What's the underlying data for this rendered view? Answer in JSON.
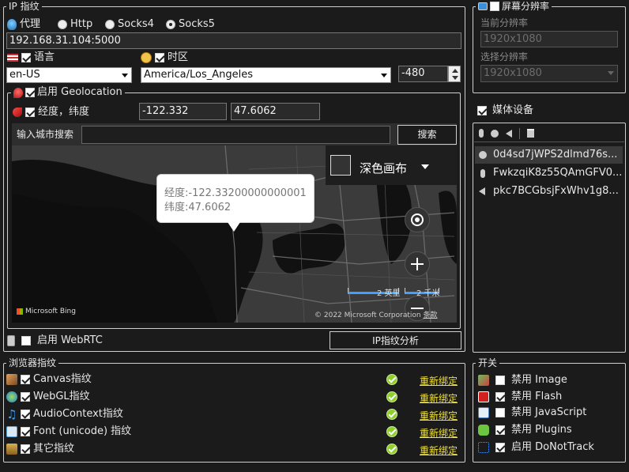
{
  "ip": {
    "title": "IP 指纹",
    "proxy_label": "代理",
    "protocols": [
      {
        "label": "Http",
        "selected": false
      },
      {
        "label": "Socks4",
        "selected": false
      },
      {
        "label": "Socks5",
        "selected": true
      }
    ],
    "address": "192.168.31.104:5000",
    "language_label": "语言",
    "language_value": "en-US",
    "timezone_label": "时区",
    "timezone_value": "America/Los_Angeles",
    "offset_value": "-480",
    "geo_label": "启用 Geolocation",
    "latlng_label": "经度，纬度",
    "longitude": "-122.332",
    "latitude": "47.6062",
    "city_search_label": "输入城市搜索",
    "search_button": "搜索",
    "map": {
      "style_label": "深色画布",
      "popup_lng": "经度:-122.33200000000001",
      "popup_lat": "纬度:47.6062",
      "scale_miles": "2 英里",
      "scale_km": "2 千米",
      "brand": "Microsoft Bing",
      "copyright": "© 2022 Microsoft Corporation",
      "terms": "条款"
    },
    "webrtc_label": "启用 WebRTC",
    "analysis_button": "IP指纹分析"
  },
  "screen": {
    "title": "屏幕分辨率",
    "current_label": "当前分辨率",
    "current_value": "1920x1080",
    "select_label": "选择分辨率",
    "select_value": "1920x1080"
  },
  "media": {
    "label": "媒体设备",
    "items": [
      {
        "icon": "webcam-icon",
        "text": "0d4sd7jWPS2dlmd76s..."
      },
      {
        "icon": "microphone-icon",
        "text": "FwkzqiK8z55QAmGFV0..."
      },
      {
        "icon": "speaker-icon",
        "text": "pkc7BCGbsjFxWhv1g8..."
      }
    ]
  },
  "browser": {
    "title": "浏览器指纹",
    "rebind_label": "重新绑定",
    "items": [
      {
        "label": "Canvas指纹",
        "icon": "canvas-icon",
        "color": "#e0a060"
      },
      {
        "label": "WebGL指纹",
        "icon": "webgl-icon",
        "color": "#3fa0d8"
      },
      {
        "label": "AudioContext指纹",
        "icon": "audio-icon",
        "color": "#3aa0ff"
      },
      {
        "label": "Font (unicode) 指纹",
        "icon": "font-icon",
        "color": "#5aa0d8"
      },
      {
        "label": "其它指纹",
        "icon": "other-fingerprint-icon",
        "color": "#d8b050"
      }
    ]
  },
  "switches": {
    "title": "开关",
    "items": [
      {
        "label": "禁用 Image",
        "checked": false,
        "icon": "image-icon"
      },
      {
        "label": "禁用 Flash",
        "checked": true,
        "icon": "flash-icon"
      },
      {
        "label": "禁用 JavaScript",
        "checked": false,
        "icon": "javascript-icon"
      },
      {
        "label": "禁用 Plugins",
        "checked": true,
        "icon": "plugin-icon"
      },
      {
        "label": "启用 DoNotTrack",
        "checked": true,
        "icon": "donottrack-icon"
      }
    ]
  }
}
